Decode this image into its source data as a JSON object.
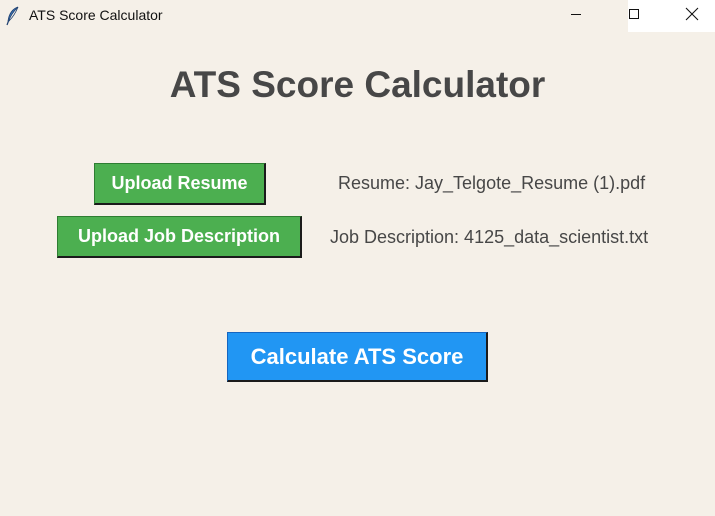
{
  "window": {
    "title": "ATS Score Calculator",
    "icon": "feather-icon",
    "controls": [
      "minimize-icon",
      "maximize-icon",
      "close-icon"
    ]
  },
  "main": {
    "heading": "ATS Score Calculator",
    "upload_resume_label": "Upload Resume",
    "upload_jd_label": "Upload Job Description",
    "resume_status": "Resume: Jay_Telgote_Resume (1).pdf",
    "jd_status": "Job Description: 4125_data_scientist.txt",
    "calculate_label": "Calculate ATS Score"
  },
  "colors": {
    "background": "#f5f0e8",
    "green_button": "#4caf50",
    "blue_button": "#2196f3",
    "text": "#474747"
  }
}
